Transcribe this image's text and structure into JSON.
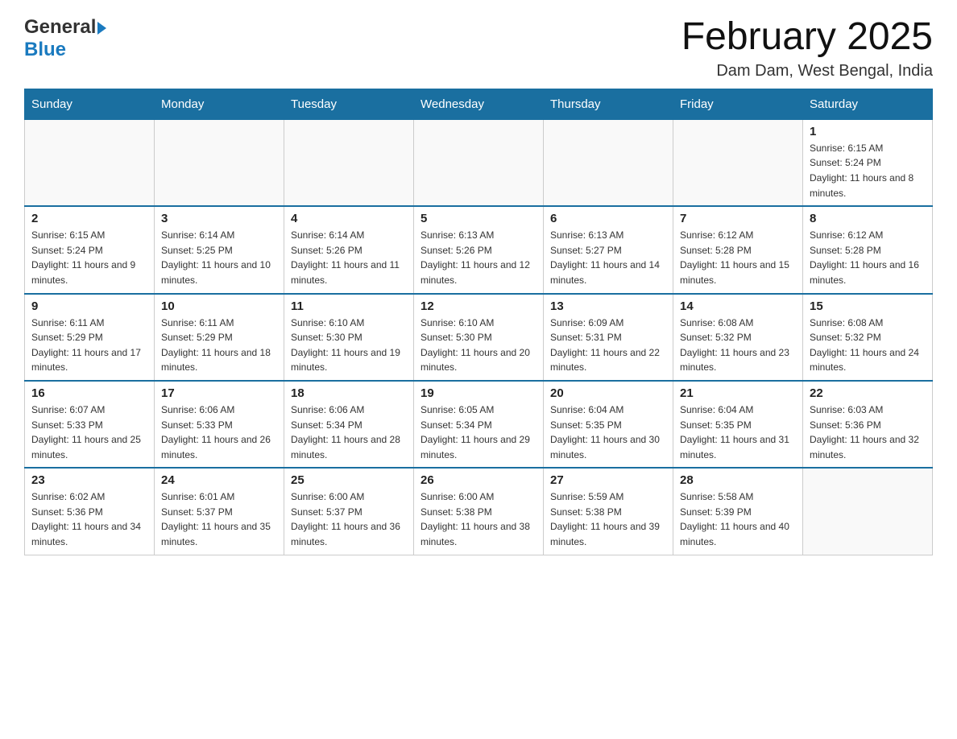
{
  "header": {
    "logo_general": "General",
    "logo_blue": "Blue",
    "month_title": "February 2025",
    "location": "Dam Dam, West Bengal, India"
  },
  "weekdays": [
    "Sunday",
    "Monday",
    "Tuesday",
    "Wednesday",
    "Thursday",
    "Friday",
    "Saturday"
  ],
  "weeks": [
    {
      "days": [
        {
          "num": "",
          "info": ""
        },
        {
          "num": "",
          "info": ""
        },
        {
          "num": "",
          "info": ""
        },
        {
          "num": "",
          "info": ""
        },
        {
          "num": "",
          "info": ""
        },
        {
          "num": "",
          "info": ""
        },
        {
          "num": "1",
          "info": "Sunrise: 6:15 AM\nSunset: 5:24 PM\nDaylight: 11 hours and 8 minutes."
        }
      ]
    },
    {
      "days": [
        {
          "num": "2",
          "info": "Sunrise: 6:15 AM\nSunset: 5:24 PM\nDaylight: 11 hours and 9 minutes."
        },
        {
          "num": "3",
          "info": "Sunrise: 6:14 AM\nSunset: 5:25 PM\nDaylight: 11 hours and 10 minutes."
        },
        {
          "num": "4",
          "info": "Sunrise: 6:14 AM\nSunset: 5:26 PM\nDaylight: 11 hours and 11 minutes."
        },
        {
          "num": "5",
          "info": "Sunrise: 6:13 AM\nSunset: 5:26 PM\nDaylight: 11 hours and 12 minutes."
        },
        {
          "num": "6",
          "info": "Sunrise: 6:13 AM\nSunset: 5:27 PM\nDaylight: 11 hours and 14 minutes."
        },
        {
          "num": "7",
          "info": "Sunrise: 6:12 AM\nSunset: 5:28 PM\nDaylight: 11 hours and 15 minutes."
        },
        {
          "num": "8",
          "info": "Sunrise: 6:12 AM\nSunset: 5:28 PM\nDaylight: 11 hours and 16 minutes."
        }
      ]
    },
    {
      "days": [
        {
          "num": "9",
          "info": "Sunrise: 6:11 AM\nSunset: 5:29 PM\nDaylight: 11 hours and 17 minutes."
        },
        {
          "num": "10",
          "info": "Sunrise: 6:11 AM\nSunset: 5:29 PM\nDaylight: 11 hours and 18 minutes."
        },
        {
          "num": "11",
          "info": "Sunrise: 6:10 AM\nSunset: 5:30 PM\nDaylight: 11 hours and 19 minutes."
        },
        {
          "num": "12",
          "info": "Sunrise: 6:10 AM\nSunset: 5:30 PM\nDaylight: 11 hours and 20 minutes."
        },
        {
          "num": "13",
          "info": "Sunrise: 6:09 AM\nSunset: 5:31 PM\nDaylight: 11 hours and 22 minutes."
        },
        {
          "num": "14",
          "info": "Sunrise: 6:08 AM\nSunset: 5:32 PM\nDaylight: 11 hours and 23 minutes."
        },
        {
          "num": "15",
          "info": "Sunrise: 6:08 AM\nSunset: 5:32 PM\nDaylight: 11 hours and 24 minutes."
        }
      ]
    },
    {
      "days": [
        {
          "num": "16",
          "info": "Sunrise: 6:07 AM\nSunset: 5:33 PM\nDaylight: 11 hours and 25 minutes."
        },
        {
          "num": "17",
          "info": "Sunrise: 6:06 AM\nSunset: 5:33 PM\nDaylight: 11 hours and 26 minutes."
        },
        {
          "num": "18",
          "info": "Sunrise: 6:06 AM\nSunset: 5:34 PM\nDaylight: 11 hours and 28 minutes."
        },
        {
          "num": "19",
          "info": "Sunrise: 6:05 AM\nSunset: 5:34 PM\nDaylight: 11 hours and 29 minutes."
        },
        {
          "num": "20",
          "info": "Sunrise: 6:04 AM\nSunset: 5:35 PM\nDaylight: 11 hours and 30 minutes."
        },
        {
          "num": "21",
          "info": "Sunrise: 6:04 AM\nSunset: 5:35 PM\nDaylight: 11 hours and 31 minutes."
        },
        {
          "num": "22",
          "info": "Sunrise: 6:03 AM\nSunset: 5:36 PM\nDaylight: 11 hours and 32 minutes."
        }
      ]
    },
    {
      "days": [
        {
          "num": "23",
          "info": "Sunrise: 6:02 AM\nSunset: 5:36 PM\nDaylight: 11 hours and 34 minutes."
        },
        {
          "num": "24",
          "info": "Sunrise: 6:01 AM\nSunset: 5:37 PM\nDaylight: 11 hours and 35 minutes."
        },
        {
          "num": "25",
          "info": "Sunrise: 6:00 AM\nSunset: 5:37 PM\nDaylight: 11 hours and 36 minutes."
        },
        {
          "num": "26",
          "info": "Sunrise: 6:00 AM\nSunset: 5:38 PM\nDaylight: 11 hours and 38 minutes."
        },
        {
          "num": "27",
          "info": "Sunrise: 5:59 AM\nSunset: 5:38 PM\nDaylight: 11 hours and 39 minutes."
        },
        {
          "num": "28",
          "info": "Sunrise: 5:58 AM\nSunset: 5:39 PM\nDaylight: 11 hours and 40 minutes."
        },
        {
          "num": "",
          "info": ""
        }
      ]
    }
  ]
}
